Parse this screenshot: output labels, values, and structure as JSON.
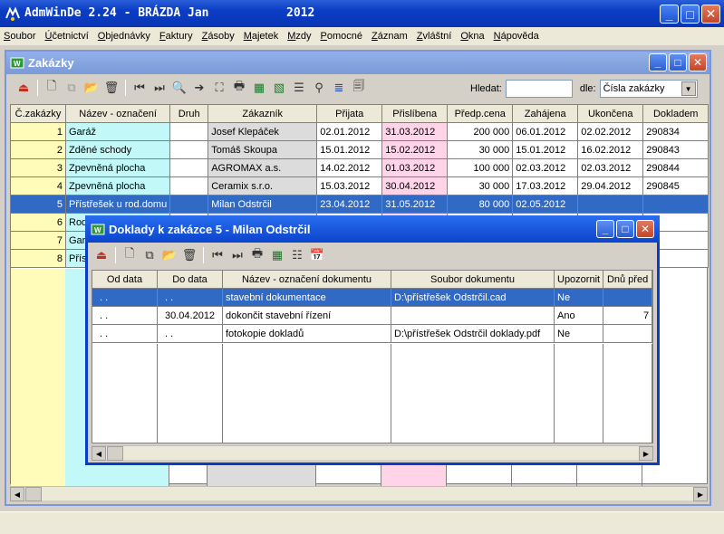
{
  "app": {
    "title": "AdmWinDe 2.24 - BRÁZDA Jan",
    "year": "2012",
    "window_buttons": {
      "minimize": "_",
      "maximize": "□",
      "close": "✕"
    }
  },
  "menu": [
    "Soubor",
    "Účetnictví",
    "Objednávky",
    "Faktury",
    "Zásoby",
    "Majetek",
    "Mzdy",
    "Pomocné",
    "Záznam",
    "Zvláštní",
    "Okna",
    "Nápověda"
  ],
  "orders_window": {
    "title": "Zakázky",
    "search": {
      "label": "Hledat:",
      "value": "",
      "by_label": "dle:",
      "by_value": "Čísla zakázky",
      "dropdown_arrow": "▼"
    },
    "scroll_arrows": {
      "left": "◀",
      "right": "▶"
    },
    "columns": [
      "Č.zakázky",
      "Název - označení",
      "Druh",
      "Zákazník",
      "Přijata",
      "Přislíbena",
      "Předp.cena",
      "Zahájena",
      "Ukončena",
      "Dokladem"
    ],
    "rows": [
      [
        "1",
        "Garáž",
        "",
        "Josef Klepáček",
        "02.01.2012",
        "31.03.2012",
        "200 000",
        "06.01.2012",
        "02.02.2012",
        "290834"
      ],
      [
        "2",
        "Zděné schody",
        "",
        "Tomáš Skoupa",
        "15.01.2012",
        "15.02.2012",
        "30 000",
        "15.01.2012",
        "16.02.2012",
        "290843"
      ],
      [
        "3",
        "Zpevněná plocha",
        "",
        "AGROMAX a.s.",
        "14.02.2012",
        "01.03.2012",
        "100 000",
        "02.03.2012",
        "02.03.2012",
        "290844"
      ],
      [
        "4",
        "Zpevněná plocha",
        "",
        "Ceramix s.r.o.",
        "15.03.2012",
        "30.04.2012",
        "30 000",
        "17.03.2012",
        "29.04.2012",
        "290845"
      ],
      [
        "5",
        "Přístřešek u rod.domu",
        "",
        "Milan Odstrčil",
        "23.04.2012",
        "31.05.2012",
        "80 000",
        "02.05.2012",
        "",
        ""
      ],
      [
        "6",
        "Rod",
        "",
        "",
        "",
        "",
        "",
        "",
        "",
        ""
      ],
      [
        "7",
        "Gara",
        "",
        "",
        "",
        "",
        "",
        "",
        "",
        ""
      ],
      [
        "8",
        "Přís",
        "",
        "",
        "",
        "",
        "",
        "",
        "",
        ""
      ]
    ],
    "selected_row": 4
  },
  "documents_dialog": {
    "title": "Doklady k zakázce 5 - Milan Odstrčil",
    "scroll_arrows": {
      "left": "◀",
      "right": "▶"
    },
    "columns": [
      "Od data",
      "Do data",
      "Název - označení dokumentu",
      "Soubor dokumentu",
      "Upozornit",
      "Dnů před"
    ],
    "rows": [
      [
        ". .",
        ". .",
        "stavební dokumentace",
        "D:\\přístřešek Odstrčil.cad",
        "Ne",
        ""
      ],
      [
        ". .",
        "30.04.2012",
        "dokončit stavební řízení",
        "",
        "Ano",
        "7"
      ],
      [
        ". .",
        ". .",
        "fotokopie dokladů",
        "D:\\přístřešek Odstrčil doklady.pdf",
        "Ne",
        ""
      ]
    ],
    "selected_row": 0
  },
  "colors": {
    "number_col": "#fffbb8",
    "name_col": "#c2f8f8",
    "customer_col": "#dcdcdc",
    "promised_col": "#ffd4e8",
    "selection": "#316ac5",
    "titlebar": "#0a3cc4"
  }
}
